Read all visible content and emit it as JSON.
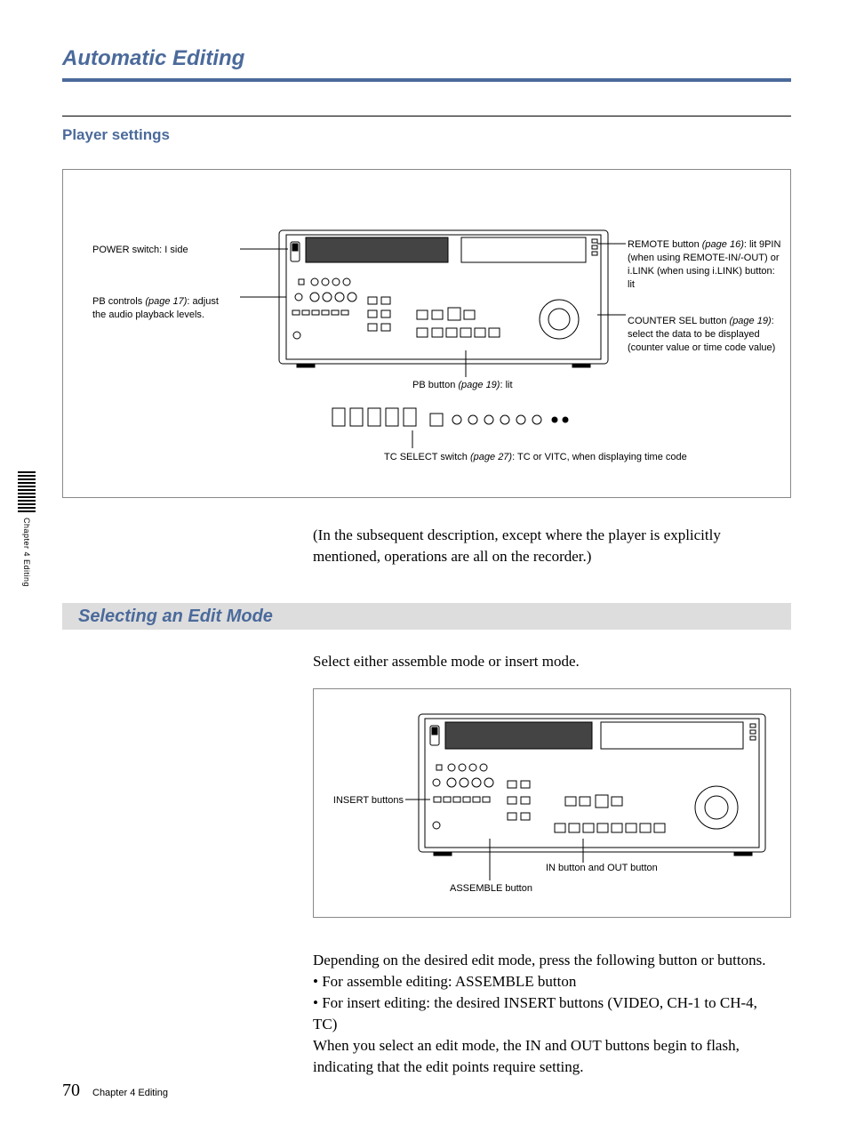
{
  "pageTitle": "Automatic Editing",
  "playerSettingsTitle": "Player settings",
  "diagram1": {
    "powerSwitch": "POWER switch: I side",
    "pbControls": {
      "pre": "PB controls ",
      "ref": "(page 17)",
      "post": ": adjust the audio playback levels."
    },
    "remoteButton": {
      "pre": "REMOTE button ",
      "ref": "(page 16)",
      "post": ": lit 9PIN (when using REMOTE-IN/-OUT) or i.LINK (when using i.LINK) button: lit"
    },
    "counterSel": {
      "pre": "COUNTER SEL button ",
      "ref": "(page 19)",
      "post": ": select the data to be displayed (counter value or time code value)"
    },
    "pbButton": {
      "pre": "PB button ",
      "ref": "(page 19)",
      "post": ": lit"
    },
    "tcSelect": {
      "pre": "TC SELECT switch ",
      "ref": "(page 27)",
      "post": ": TC or VITC, when displaying time code"
    }
  },
  "parenNote": "(In the subsequent description, except where the player is explicitly mentioned, operations are all on the recorder.)",
  "sectionTitle": "Selecting an Edit Mode",
  "bodyIntro": "Select either assemble mode or insert mode.",
  "diagram2": {
    "insertButtons": "INSERT buttons",
    "inOut": "IN button and OUT button",
    "assemble": "ASSEMBLE button"
  },
  "body2": "Depending on the desired edit mode, press the following button or buttons.",
  "bullet1": "For assemble editing: ASSEMBLE button",
  "bullet2": "For insert editing: the desired INSERT buttons (VIDEO, CH-1 to CH-4, TC)",
  "body3": "When you select an edit mode, the IN and OUT buttons begin to flash, indicating that the edit points require setting.",
  "pageNumber": "70",
  "footerLabel": "Chapter 4    Editing",
  "sideLabel": "Chapter 4    Editing"
}
